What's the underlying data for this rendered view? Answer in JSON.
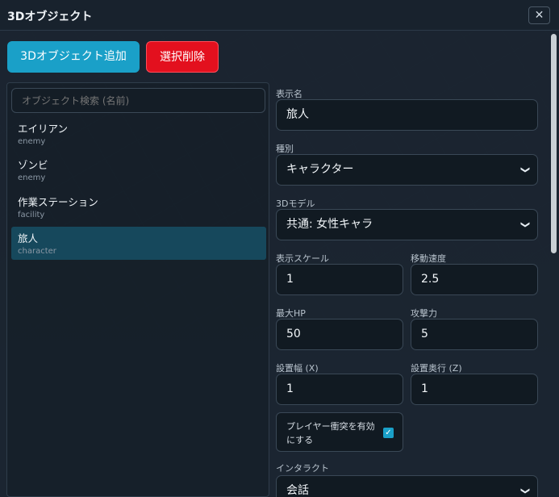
{
  "window": {
    "title": "3Dオブジェクト",
    "close_label": "✕"
  },
  "toolbar": {
    "add_label": "3Dオブジェクト追加",
    "delete_label": "選択削除"
  },
  "search": {
    "placeholder": "オブジェクト検索 (名前)"
  },
  "objects": [
    {
      "name": "エイリアン",
      "type": "enemy",
      "selected": false
    },
    {
      "name": "ゾンビ",
      "type": "enemy",
      "selected": false
    },
    {
      "name": "作業ステーション",
      "type": "facility",
      "selected": false
    },
    {
      "name": "旅人",
      "type": "character",
      "selected": true
    }
  ],
  "form": {
    "display_name": {
      "label": "表示名",
      "value": "旅人"
    },
    "kind": {
      "label": "種別",
      "value": "キャラクター"
    },
    "model": {
      "label": "3Dモデル",
      "value": "共通: 女性キャラ"
    },
    "scale": {
      "label": "表示スケール",
      "value": "1"
    },
    "speed": {
      "label": "移動速度",
      "value": "2.5"
    },
    "max_hp": {
      "label": "最大HP",
      "value": "50"
    },
    "attack": {
      "label": "攻撃力",
      "value": "5"
    },
    "width_x": {
      "label": "設置幅 (X)",
      "value": "1"
    },
    "depth_z": {
      "label": "設置奥行 (Z)",
      "value": "1"
    },
    "collision": {
      "label": "プレイヤー衝突を有効にする",
      "checked": true
    },
    "interact": {
      "label": "インタラクト",
      "value": "会話"
    }
  },
  "colors": {
    "accent": "#1aa0c8",
    "danger": "#e3101e",
    "selected_row": "#16485c"
  },
  "icons": {
    "close": "close-icon",
    "dropdown": "chevron-down-icon",
    "check": "check-icon"
  }
}
